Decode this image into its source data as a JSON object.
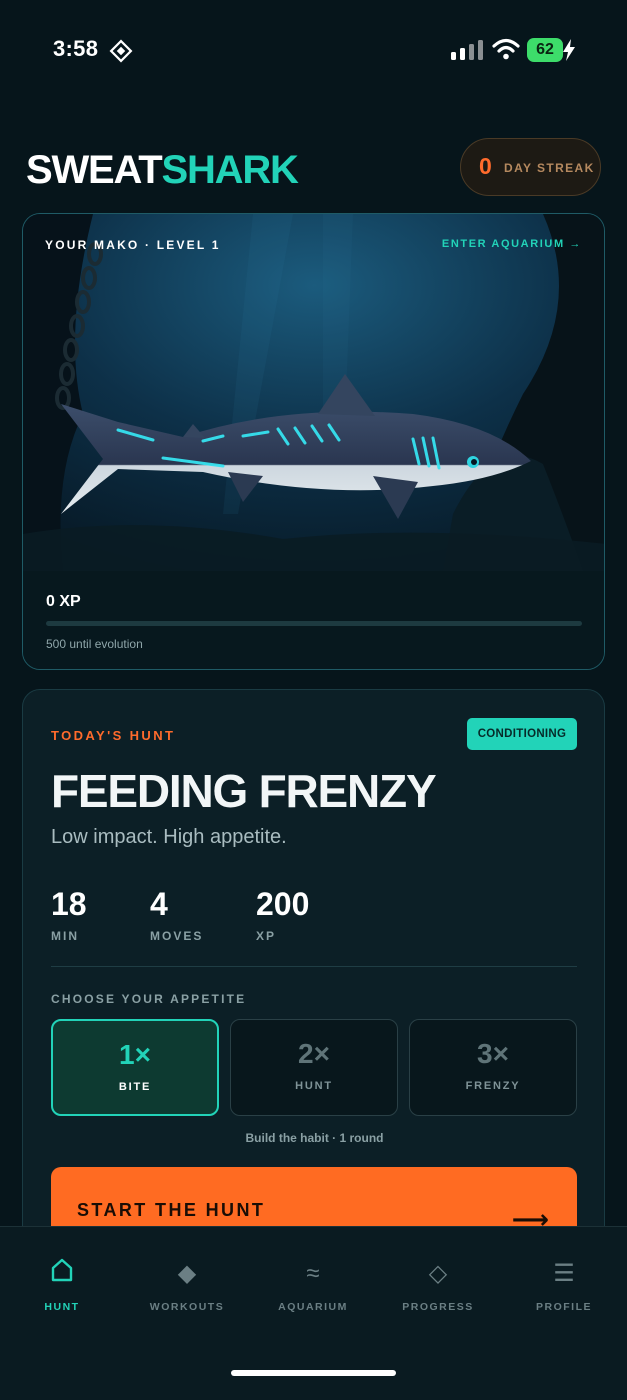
{
  "status_bar": {
    "time": "3:58",
    "battery": "62",
    "icons": [
      "focus-icon",
      "cellular-signal-icon",
      "wifi-icon",
      "battery-icon",
      "charging-bolt-icon"
    ]
  },
  "header": {
    "brand_part1": "SWEAT",
    "brand_part2": "SHARK",
    "streak_count": "0",
    "streak_label": "DAY STREAK"
  },
  "mako": {
    "label": "YOUR MAKO · LEVEL 1",
    "aquarium_link": "ENTER AQUARIUM →",
    "xp": "0 XP",
    "xp_progress": 0,
    "evolution_note": "500 until evolution"
  },
  "hunt": {
    "kicker": "TODAY'S HUNT",
    "category": "CONDITIONING",
    "title": "FEEDING FRENZY",
    "subtitle": "Low impact. High appetite.",
    "stats": [
      {
        "value": "18",
        "label": "MIN"
      },
      {
        "value": "4",
        "label": "MOVES"
      },
      {
        "value": "200",
        "label": "XP"
      }
    ],
    "appetite_heading": "CHOOSE YOUR APPETITE",
    "appetite_options": [
      {
        "mult": "1×",
        "name": "BITE",
        "selected": true
      },
      {
        "mult": "2×",
        "name": "HUNT",
        "selected": false
      },
      {
        "mult": "3×",
        "name": "FRENZY",
        "selected": false
      }
    ],
    "appetite_note": "Build the habit · 1 round",
    "start_label": "START THE HUNT",
    "start_arrow": "⟶"
  },
  "tabs": [
    {
      "label": "HUNT",
      "icon": "home-icon",
      "glyph": "",
      "active": true
    },
    {
      "label": "WORKOUTS",
      "icon": "diamond-filled-icon",
      "glyph": "◆",
      "active": false
    },
    {
      "label": "AQUARIUM",
      "icon": "waves-icon",
      "glyph": "≈",
      "active": false
    },
    {
      "label": "PROGRESS",
      "icon": "diamond-outline-icon",
      "glyph": "◇",
      "active": false
    },
    {
      "label": "PROFILE",
      "icon": "menu-icon",
      "glyph": "☰",
      "active": false
    }
  ],
  "colors": {
    "background": "#06151b",
    "accent_teal": "#22d3b8",
    "accent_orange": "#ff6b22"
  }
}
